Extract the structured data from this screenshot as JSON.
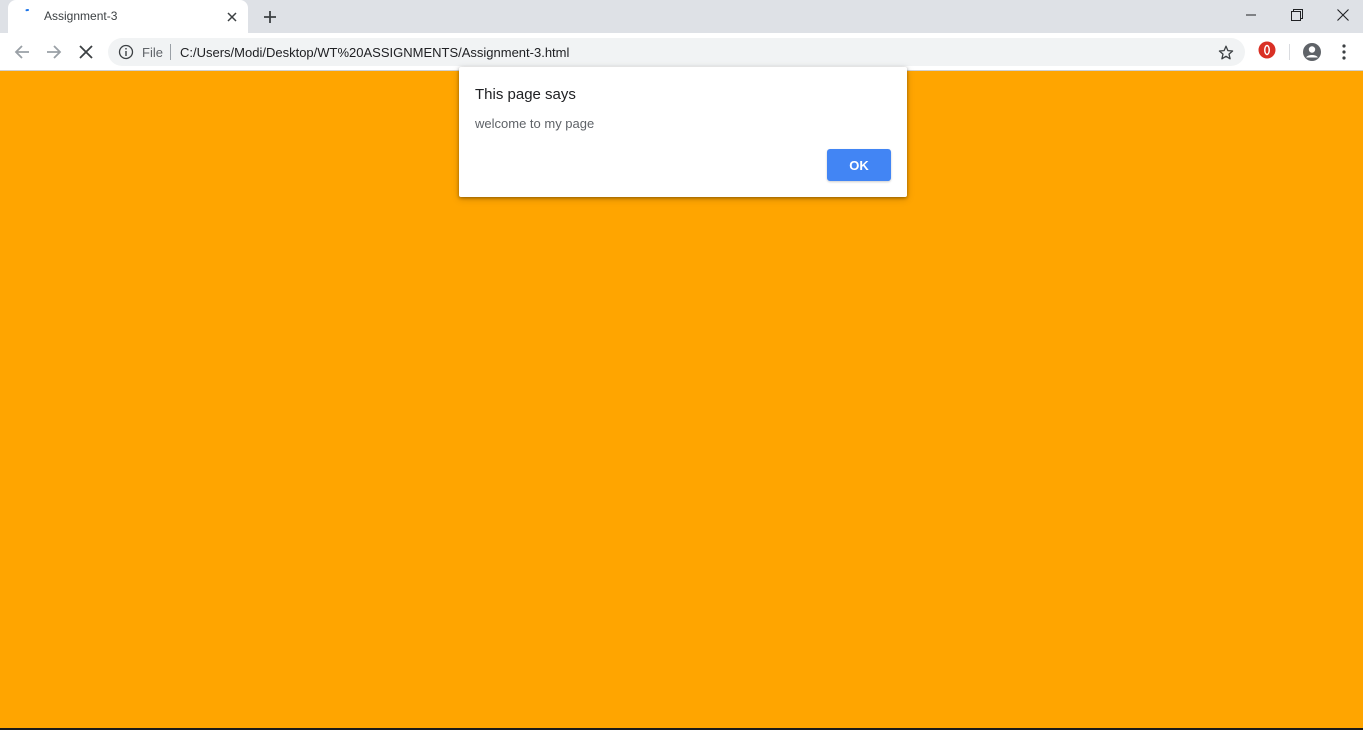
{
  "browser": {
    "tab": {
      "title": "Assignment-3"
    },
    "address": {
      "scheme_label": "File",
      "url": "C:/Users/Modi/Desktop/WT%20ASSIGNMENTS/Assignment-3.html"
    }
  },
  "page": {
    "background_color": "#ffa500"
  },
  "dialog": {
    "title": "This page says",
    "message": "welcome to my page",
    "ok_label": "OK"
  },
  "colors": {
    "accent": "#4285f4",
    "extension_red": "#d93025"
  },
  "icons": [
    "favicon-loading-icon",
    "close-icon",
    "plus-icon",
    "minimize-icon",
    "restore-icon",
    "window-close-icon",
    "back-arrow-icon",
    "forward-arrow-icon",
    "stop-icon",
    "info-icon",
    "star-icon",
    "opera-extension-icon",
    "profile-icon",
    "kebab-menu-icon"
  ]
}
